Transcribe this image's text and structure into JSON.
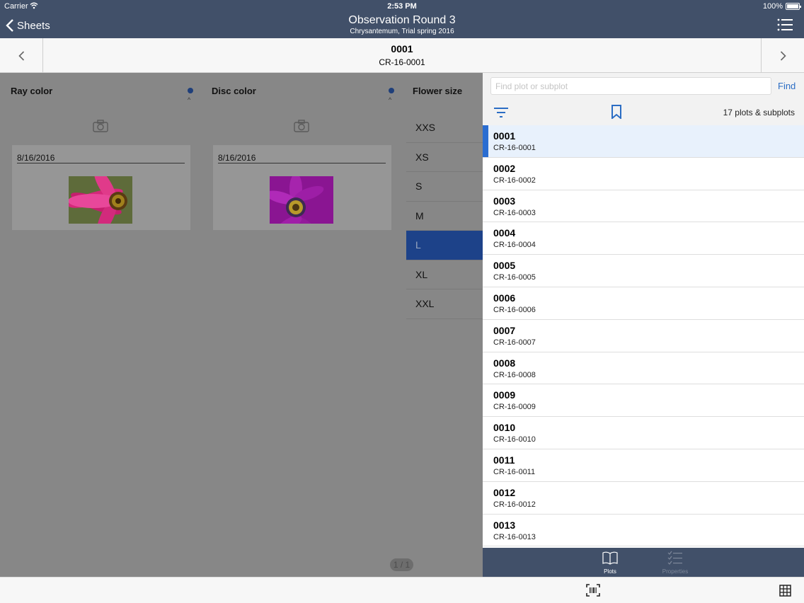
{
  "status_bar": {
    "carrier": "Carrier",
    "time": "2:53 PM",
    "battery": "100%"
  },
  "nav": {
    "back_label": "Sheets",
    "title": "Observation Round 3",
    "subtitle": "Chrysantemum, Trial spring 2016"
  },
  "plot": {
    "id": "0001",
    "code": "CR-16-0001"
  },
  "columns": [
    {
      "title": "Ray color",
      "date": "8/16/2016"
    },
    {
      "title": "Disc color",
      "date": "8/16/2016"
    },
    {
      "title": "Flower size"
    }
  ],
  "flower_sizes": [
    "XXS",
    "XS",
    "S",
    "M",
    "L",
    "XL",
    "XXL"
  ],
  "selected_size": "L",
  "pager": "1 / 1",
  "panel": {
    "search_placeholder": "Find plot or subplot",
    "find_label": "Find",
    "count_label": "17 plots & subplots",
    "items": [
      {
        "id": "0001",
        "code": "CR-16-0001"
      },
      {
        "id": "0002",
        "code": "CR-16-0002"
      },
      {
        "id": "0003",
        "code": "CR-16-0003"
      },
      {
        "id": "0004",
        "code": "CR-16-0004"
      },
      {
        "id": "0005",
        "code": "CR-16-0005"
      },
      {
        "id": "0006",
        "code": "CR-16-0006"
      },
      {
        "id": "0007",
        "code": "CR-16-0007"
      },
      {
        "id": "0008",
        "code": "CR-16-0008"
      },
      {
        "id": "0009",
        "code": "CR-16-0009"
      },
      {
        "id": "0010",
        "code": "CR-16-0010"
      },
      {
        "id": "0011",
        "code": "CR-16-0011"
      },
      {
        "id": "0012",
        "code": "CR-16-0012"
      },
      {
        "id": "0013",
        "code": "CR-16-0013"
      }
    ],
    "selected_item": "0001",
    "tabs": [
      {
        "label": "Plots",
        "icon": "book-icon",
        "active": true
      },
      {
        "label": "Properties",
        "icon": "checklist-icon",
        "active": false
      }
    ]
  },
  "colors": {
    "nav_bg": "#415069",
    "accent": "#2b6dc4",
    "selected_size_bg": "#1d4289",
    "ray_photo": "#d4287a",
    "disc_photo": "#9a1b9e"
  }
}
